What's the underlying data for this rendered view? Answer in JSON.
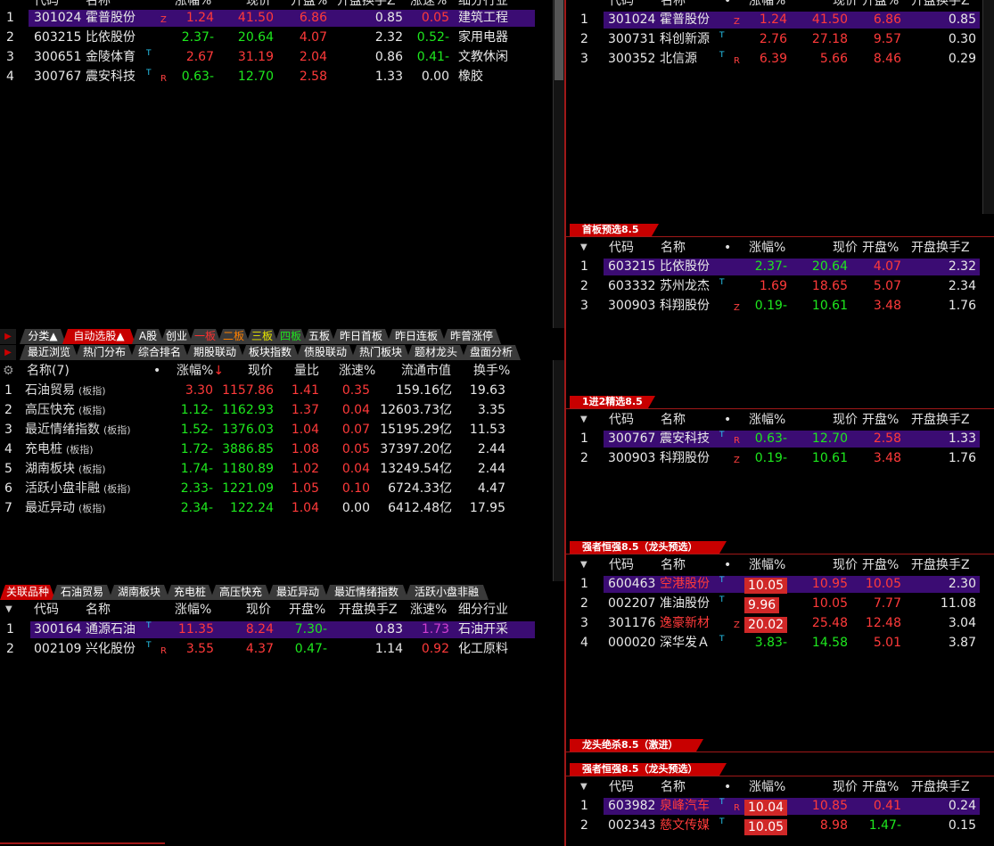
{
  "tl": {
    "headers": [
      "代码",
      "名称",
      "涨幅%",
      "现价",
      "开盘%",
      "开盘换手Z",
      "涨速%",
      "细分行业"
    ],
    "rows": [
      {
        "no": "1",
        "code": "301024",
        "name": "霍普股份",
        "tag": "Z",
        "chg": "1.24",
        "price": "41.50",
        "open": "6.86",
        "turn": "0.85",
        "speed": "0.05",
        "ind": "建筑工程"
      },
      {
        "no": "2",
        "code": "603215",
        "name": "比依股份",
        "tag": "",
        "chg": "-2.37",
        "price": "20.64",
        "open": "4.07",
        "turn": "2.32",
        "speed": "-0.52",
        "ind": "家用电器"
      },
      {
        "no": "3",
        "code": "300651",
        "name": "金陵体育",
        "tag": "T",
        "chg": "2.67",
        "price": "31.19",
        "open": "2.04",
        "turn": "0.86",
        "speed": "-0.41",
        "ind": "文教休闲"
      },
      {
        "no": "4",
        "code": "300767",
        "name": "震安科技",
        "tag": "TR",
        "chg": "-0.63",
        "price": "12.70",
        "open": "2.58",
        "turn": "1.33",
        "speed": "0.00",
        "ind": "橡胶"
      }
    ]
  },
  "tabs1": [
    "分类▲",
    "自动选股▲",
    "A股",
    "创业",
    "一板",
    "二板",
    "三板",
    "四板",
    "五板",
    "昨日首板",
    "昨日连板",
    "昨曾涨停"
  ],
  "tabs2": [
    "最近浏览",
    "热门分布",
    "综合排名",
    "期股联动",
    "板块指数",
    "债股联动",
    "热门板块",
    "题材龙头",
    "盘面分析"
  ],
  "ml": {
    "headers": [
      "名称(7)",
      "涨幅%",
      "现价",
      "量比",
      "涨速%",
      "流通市值",
      "换手%"
    ],
    "rows": [
      {
        "no": "1",
        "name": "石油贸易",
        "sfx": "(板指)",
        "chg": "3.30",
        "price": "1157.86",
        "vr": "1.41",
        "speed": "0.35",
        "cap": "159.16亿",
        "turn": "19.63"
      },
      {
        "no": "2",
        "name": "高压快充",
        "sfx": "(板指)",
        "chg": "-1.12",
        "price": "1162.93",
        "vr": "1.37",
        "speed": "0.04",
        "cap": "12603.73亿",
        "turn": "3.35"
      },
      {
        "no": "3",
        "name": "最近情绪指数",
        "sfx": "(板指)",
        "chg": "-1.52",
        "price": "1376.03",
        "vr": "1.04",
        "speed": "0.07",
        "cap": "15195.29亿",
        "turn": "11.53"
      },
      {
        "no": "4",
        "name": "充电桩",
        "sfx": "(板指)",
        "chg": "-1.72",
        "price": "3886.85",
        "vr": "1.08",
        "speed": "0.05",
        "cap": "37397.20亿",
        "turn": "2.44"
      },
      {
        "no": "5",
        "name": "湖南板块",
        "sfx": "(板指)",
        "chg": "-1.74",
        "price": "1180.89",
        "vr": "1.02",
        "speed": "0.04",
        "cap": "13249.54亿",
        "turn": "2.44"
      },
      {
        "no": "6",
        "name": "活跃小盘非融",
        "sfx": "(板指)",
        "chg": "-2.33",
        "price": "1221.09",
        "vr": "1.05",
        "speed": "0.10",
        "cap": "6724.33亿",
        "turn": "4.47"
      },
      {
        "no": "7",
        "name": "最近异动",
        "sfx": "(板指)",
        "chg": "-2.34",
        "price": "122.24",
        "vr": "1.04",
        "speed": "0.00",
        "cap": "6412.48亿",
        "turn": "17.95"
      }
    ]
  },
  "tabs3": [
    "关联品种",
    "石油贸易",
    "湖南板块",
    "充电桩",
    "高压快充",
    "最近异动",
    "最近情绪指数",
    "活跃小盘非融"
  ],
  "bl": {
    "headers": [
      "代码",
      "名称",
      "涨幅%",
      "现价",
      "开盘%",
      "开盘换手Z",
      "涨速%",
      "细分行业"
    ],
    "rows": [
      {
        "no": "1",
        "code": "300164",
        "name": "通源石油",
        "tag": "T",
        "chg": "11.35",
        "price": "8.24",
        "open": "-7.30",
        "turn": "0.83",
        "speed": "1.73",
        "ind": "石油开采"
      },
      {
        "no": "2",
        "code": "002109",
        "name": "兴化股份",
        "tag": "TR",
        "chg": "3.55",
        "price": "4.37",
        "open": "-0.47",
        "turn": "1.14",
        "speed": "0.92",
        "ind": "化工原料"
      }
    ]
  },
  "rheaders": [
    "代码",
    "名称",
    "•",
    "涨幅%",
    "现价",
    "开盘%",
    "开盘换手Z"
  ],
  "r1": {
    "rows": [
      {
        "no": "1",
        "code": "301024",
        "name": "霍普股份",
        "tag": "Z",
        "chg": "1.24",
        "price": "41.50",
        "open": "6.86",
        "turn": "0.85"
      },
      {
        "no": "2",
        "code": "300731",
        "name": "科创新源",
        "tag": "T",
        "chg": "2.76",
        "price": "27.18",
        "open": "9.57",
        "turn": "0.30"
      },
      {
        "no": "3",
        "code": "300352",
        "name": "北信源",
        "tag": "TR",
        "chg": "6.39",
        "price": "5.66",
        "open": "8.46",
        "turn": "0.29"
      }
    ]
  },
  "r2": {
    "title": "首板预选8.5",
    "rows": [
      {
        "no": "1",
        "code": "603215",
        "name": "比依股份",
        "tag": "",
        "chg": "-2.37",
        "price": "20.64",
        "open": "4.07",
        "turn": "2.32"
      },
      {
        "no": "2",
        "code": "603332",
        "name": "苏州龙杰",
        "tag": "T",
        "chg": "1.69",
        "price": "18.65",
        "open": "5.07",
        "turn": "2.34"
      },
      {
        "no": "3",
        "code": "300903",
        "name": "科翔股份",
        "tag": "Z",
        "chg": "-0.19",
        "price": "10.61",
        "open": "3.48",
        "turn": "1.76"
      }
    ]
  },
  "r3": {
    "title": "1进2精选8.5",
    "rows": [
      {
        "no": "1",
        "code": "300767",
        "name": "震安科技",
        "tag": "TR",
        "chg": "-0.63",
        "price": "12.70",
        "open": "2.58",
        "turn": "1.33"
      },
      {
        "no": "2",
        "code": "300903",
        "name": "科翔股份",
        "tag": "Z",
        "chg": "-0.19",
        "price": "10.61",
        "open": "3.48",
        "turn": "1.76"
      }
    ]
  },
  "r4": {
    "title": "强者恒强8.5（龙头预选）",
    "rows": [
      {
        "no": "1",
        "code": "600463",
        "name": "空港股份",
        "tag": "T",
        "chg": "10.05",
        "price": "10.95",
        "open": "10.05",
        "turn": "2.30"
      },
      {
        "no": "2",
        "code": "002207",
        "name": "准油股份",
        "tag": "T",
        "chg": "9.96",
        "price": "10.05",
        "open": "7.77",
        "turn": "11.08"
      },
      {
        "no": "3",
        "code": "301176",
        "name": "逸豪新材",
        "tag": "Z",
        "chg": "20.02",
        "price": "25.48",
        "open": "12.48",
        "turn": "3.04"
      },
      {
        "no": "4",
        "code": "000020",
        "name": "深华发Ａ",
        "tag": "T",
        "chg": "-3.83",
        "price": "14.58",
        "open": "5.01",
        "turn": "3.87"
      }
    ]
  },
  "r5": {
    "title": "龙头绝杀8.5（激进）"
  },
  "r6": {
    "title": "强者恒强8.5（龙头预选）",
    "rows": [
      {
        "no": "1",
        "code": "603982",
        "name": "泉峰汽车",
        "tag": "TR",
        "chg": "10.04",
        "price": "10.85",
        "open": "0.41",
        "turn": "0.24"
      },
      {
        "no": "2",
        "code": "002343",
        "name": "慈文传媒",
        "tag": "T",
        "chg": "10.05",
        "price": "8.98",
        "open": "-1.47",
        "turn": "0.15"
      }
    ]
  },
  "colors": {
    "up": "#ff3a3a",
    "down": "#1ee81e",
    "select": "#3b0c73",
    "accent": "#c80000"
  }
}
